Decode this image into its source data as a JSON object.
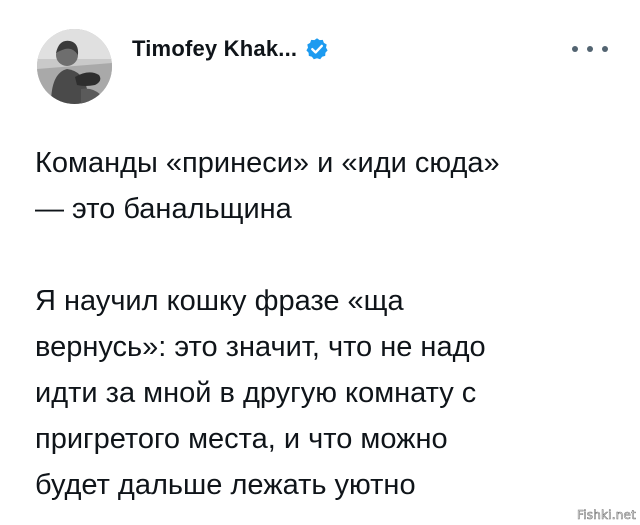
{
  "author": {
    "name": "Timofey Khak...",
    "verified_icon": "verified-badge-icon",
    "avatar": "profile-photo"
  },
  "menu": {
    "icon": "more-options-icon"
  },
  "tweet": {
    "paragraph1": [
      "Команды «принеси» и «иди сюда»",
      "— это банальщина"
    ],
    "paragraph2": [
      "Я научил кошку фразе «ща",
      "вернусь»: это значит, что не надо",
      "идти за мной в другую комнату с",
      "пригретого места, и что можно",
      "будет дальше лежать уютно"
    ]
  },
  "watermark": {
    "text": "Fishki.net"
  },
  "colors": {
    "text": "#0f1419",
    "verified": "#1d9bf0",
    "secondary": "#536471",
    "background": "#ffffff"
  }
}
